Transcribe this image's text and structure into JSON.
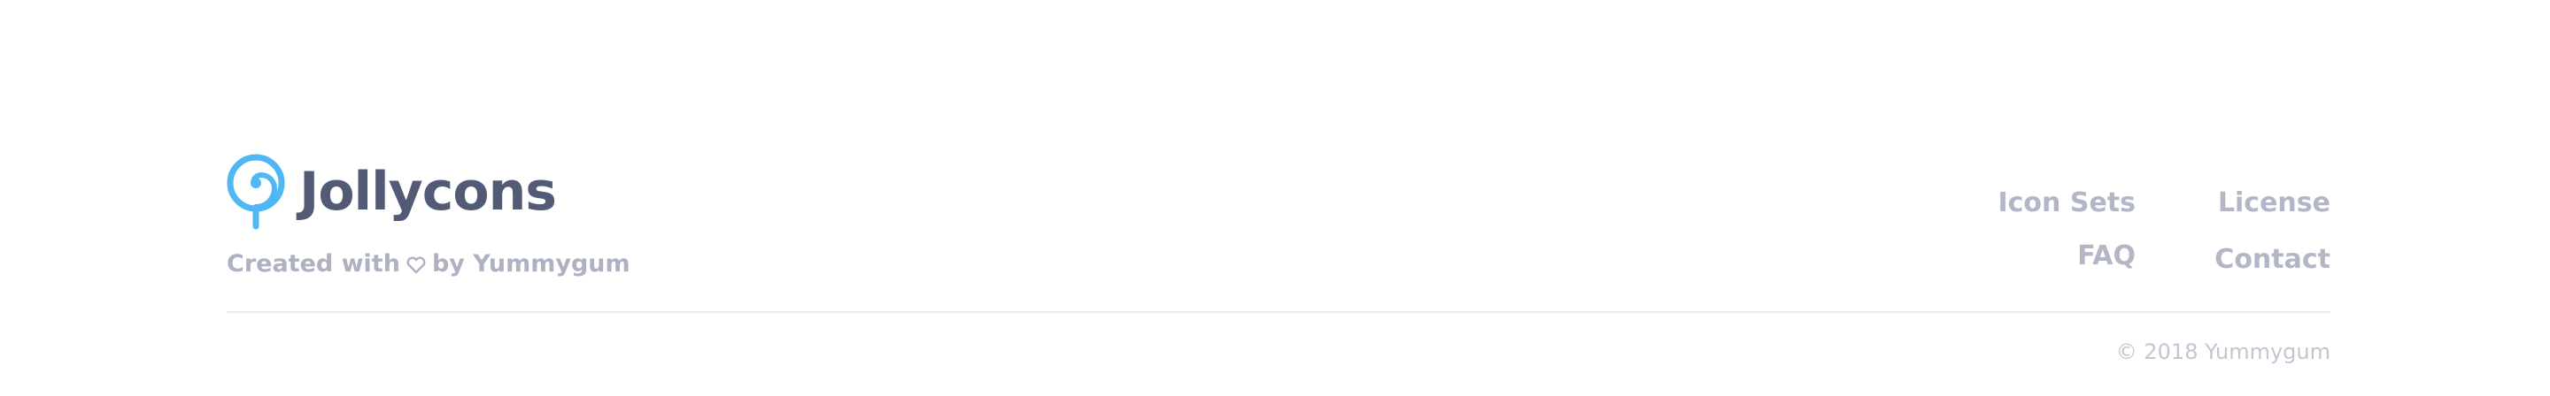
{
  "brand": {
    "name": "Jollycons",
    "logo_icon": "lollipop-icon",
    "logo_color": "#4fb8f4"
  },
  "tagline": {
    "prefix": "Created with",
    "icon": "heart-icon",
    "suffix": "by Yummygum"
  },
  "nav": {
    "icon_sets": "Icon Sets",
    "license": "License",
    "faq": "FAQ",
    "contact": "Contact"
  },
  "copyright": "© 2018 Yummygum",
  "colors": {
    "brand_text": "#525a76",
    "muted_text": "#b3b6c6",
    "divider": "#e9eaee"
  }
}
